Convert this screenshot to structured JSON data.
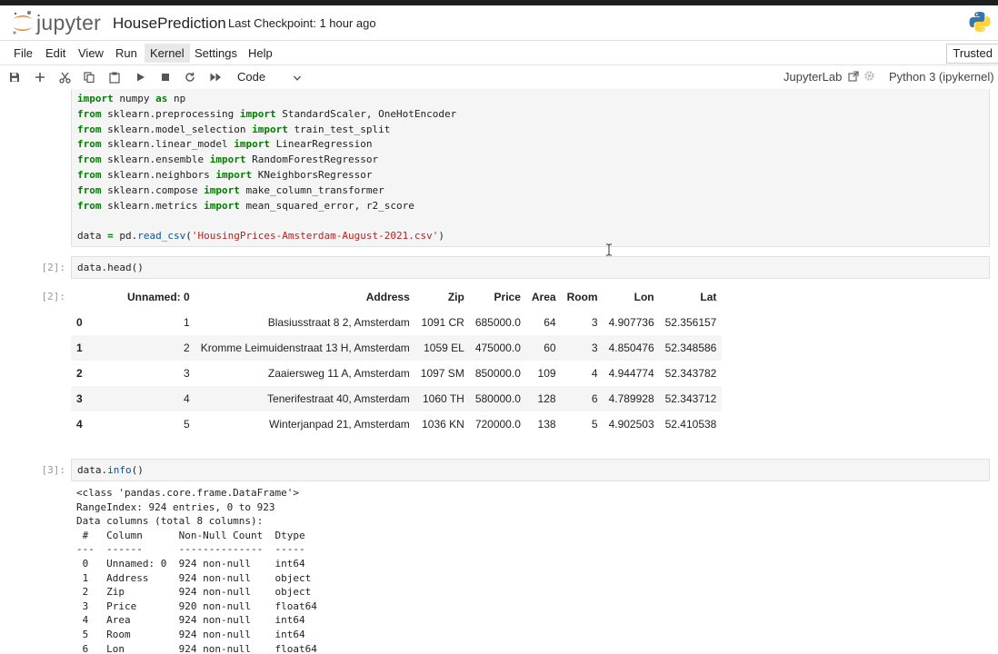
{
  "app": {
    "logo_text": "jupyter",
    "notebook_title": "HousePrediction",
    "checkpoint": "Last Checkpoint: 1 hour ago",
    "trusted": "Trusted",
    "jupyterlab_link": "JupyterLab",
    "kernel": "Python 3 (ipykernel)"
  },
  "menu": [
    "File",
    "Edit",
    "View",
    "Run",
    "Kernel",
    "Settings",
    "Help"
  ],
  "toolbar": {
    "cell_type": "Code",
    "icons": [
      "save-icon",
      "add-cell-icon",
      "cut-icon",
      "copy-icon",
      "paste-icon",
      "run-icon",
      "stop-icon",
      "restart-icon",
      "fast-forward-icon"
    ]
  },
  "cell1": {
    "lines": [
      {
        "kw1": "import",
        "rest": " numpy ",
        "kw2": "as",
        "tail": " np"
      },
      {
        "kw1": "from",
        "rest": " sklearn.preprocessing ",
        "kw2": "import",
        "tail": " StandardScaler, OneHotEncoder"
      },
      {
        "kw1": "from",
        "rest": " sklearn.model_selection ",
        "kw2": "import",
        "tail": " train_test_split"
      },
      {
        "kw1": "from",
        "rest": " sklearn.linear_model ",
        "kw2": "import",
        "tail": " LinearRegression"
      },
      {
        "kw1": "from",
        "rest": " sklearn.ensemble ",
        "kw2": "import",
        "tail": " RandomForestRegressor"
      },
      {
        "kw1": "from",
        "rest": " sklearn.neighbors ",
        "kw2": "import",
        "tail": " KNeighborsRegressor"
      },
      {
        "kw1": "from",
        "rest": " sklearn.compose ",
        "kw2": "import",
        "tail": " make_column_transformer"
      },
      {
        "kw1": "from",
        "rest": " sklearn.metrics ",
        "kw2": "import",
        "tail": " mean_squared_error, r2_score"
      }
    ],
    "data_line_pre": "data ",
    "data_line_eq": "=",
    "data_line_mid": " pd.",
    "data_line_fn": "read_csv",
    "data_line_open": "(",
    "data_line_str": "'HousingPrices-Amsterdam-August-2021.csv'",
    "data_line_close": ")"
  },
  "cell2": {
    "prompt": "[2]:",
    "code": "data.head()",
    "out_prompt": "[2]:",
    "columns": [
      "",
      "Unnamed: 0",
      "Address",
      "Zip",
      "Price",
      "Area",
      "Room",
      "Lon",
      "Lat"
    ],
    "rows": [
      [
        "0",
        "1",
        "Blasiusstraat 8 2, Amsterdam",
        "1091 CR",
        "685000.0",
        "64",
        "3",
        "4.907736",
        "52.356157"
      ],
      [
        "1",
        "2",
        "Kromme Leimuidenstraat 13 H, Amsterdam",
        "1059 EL",
        "475000.0",
        "60",
        "3",
        "4.850476",
        "52.348586"
      ],
      [
        "2",
        "3",
        "Zaaiersweg 11 A, Amsterdam",
        "1097 SM",
        "850000.0",
        "109",
        "4",
        "4.944774",
        "52.343782"
      ],
      [
        "3",
        "4",
        "Tenerifestraat 40, Amsterdam",
        "1060 TH",
        "580000.0",
        "128",
        "6",
        "4.789928",
        "52.343712"
      ],
      [
        "4",
        "5",
        "Winterjanpad 21, Amsterdam",
        "1036 KN",
        "720000.0",
        "138",
        "5",
        "4.902503",
        "52.410538"
      ]
    ]
  },
  "cell3": {
    "prompt": "[3]:",
    "code_pre": "data.",
    "code_fn": "info",
    "code_post": "()",
    "output_lines": [
      "<class 'pandas.core.frame.DataFrame'>",
      "RangeIndex: 924 entries, 0 to 923",
      "Data columns (total 8 columns):",
      " #   Column      Non-Null Count  Dtype  ",
      "---  ------      --------------  -----  ",
      " 0   Unnamed: 0  924 non-null    int64  ",
      " 1   Address     924 non-null    object ",
      " 2   Zip         924 non-null    object ",
      " 3   Price       920 non-null    float64",
      " 4   Area        924 non-null    int64  ",
      " 5   Room        924 non-null    int64  ",
      " 6   Lon         924 non-null    float64"
    ]
  }
}
